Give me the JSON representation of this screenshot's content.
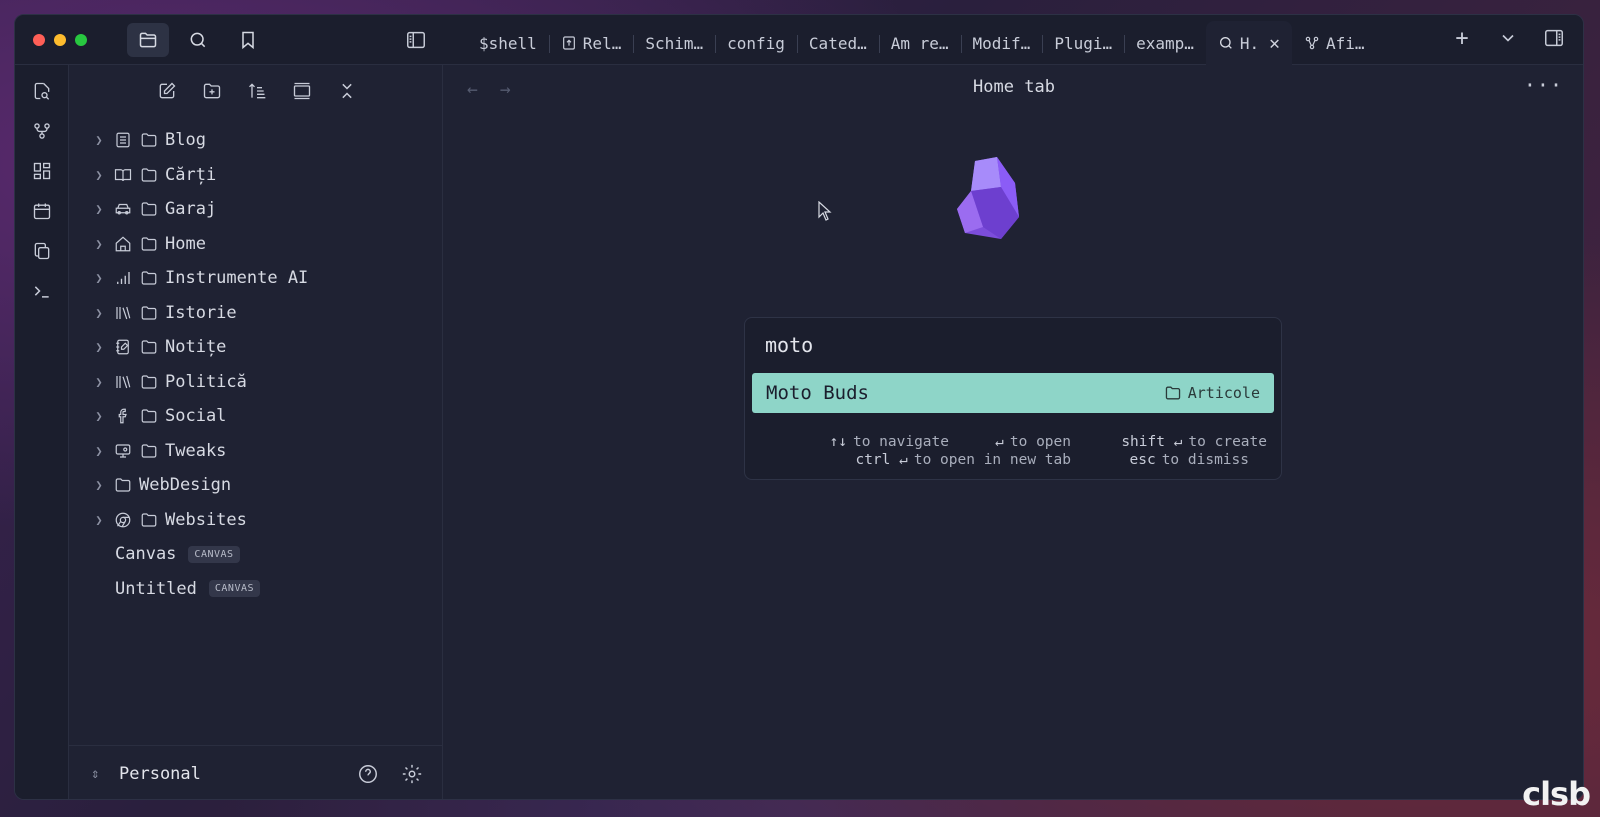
{
  "titlebar": {
    "tabs": [
      {
        "label": "$shell",
        "icon": "none"
      },
      {
        "label": "Rel…",
        "icon": "export-icon"
      },
      {
        "label": "Schim…",
        "icon": "none"
      },
      {
        "label": "config",
        "icon": "none"
      },
      {
        "label": "Cated…",
        "icon": "none"
      },
      {
        "label": "Am re…",
        "icon": "none"
      },
      {
        "label": "Modif…",
        "icon": "none"
      },
      {
        "label": "Plugi…",
        "icon": "none"
      },
      {
        "label": "examp…",
        "icon": "none"
      },
      {
        "label": "H.",
        "icon": "search-icon",
        "active": true
      },
      {
        "label": "Afi…",
        "icon": "graph-icon"
      }
    ]
  },
  "file_toolbar": [
    "new-note-icon",
    "new-folder-icon",
    "sort-icon",
    "collapse-icon",
    "close-icon"
  ],
  "tree": {
    "folders": [
      {
        "label": "Blog",
        "icon": "list-icon"
      },
      {
        "label": "Cărți",
        "icon": "book-open-icon"
      },
      {
        "label": "Garaj",
        "icon": "car-icon"
      },
      {
        "label": "Home",
        "icon": "home-icon"
      },
      {
        "label": "Instrumente AI",
        "icon": "bar-chart-icon"
      },
      {
        "label": "Istorie",
        "icon": "library-icon"
      },
      {
        "label": "Notițe",
        "icon": "notebook-icon"
      },
      {
        "label": "Politică",
        "icon": "library-icon"
      },
      {
        "label": "Social",
        "icon": "facebook-icon"
      },
      {
        "label": "Tweaks",
        "icon": "monitor-icon"
      },
      {
        "label": "WebDesign",
        "icon": "none"
      },
      {
        "label": "Websites",
        "icon": "chrome-icon"
      }
    ],
    "files": [
      {
        "label": "Canvas",
        "badge": "CANVAS"
      },
      {
        "label": "Untitled",
        "badge": "CANVAS"
      }
    ]
  },
  "vault": {
    "name": "Personal"
  },
  "main": {
    "title": "Home tab",
    "search": {
      "value": "moto",
      "result_title": "Moto Buds",
      "result_path": "Articole",
      "hints": {
        "navigate_key": "↑↓",
        "navigate": "to navigate",
        "open_key": "↵",
        "open": "to open",
        "create_key": "shift ↵",
        "create": "to create",
        "newtab_key": "ctrl ↵",
        "newtab": "to open in new tab",
        "dismiss_key": "esc",
        "dismiss": "to dismiss"
      }
    }
  },
  "watermark": "clsb",
  "colors": {
    "accent": "#8ed5c8",
    "background": "#1f2233",
    "logo": "#8b5cf6"
  }
}
